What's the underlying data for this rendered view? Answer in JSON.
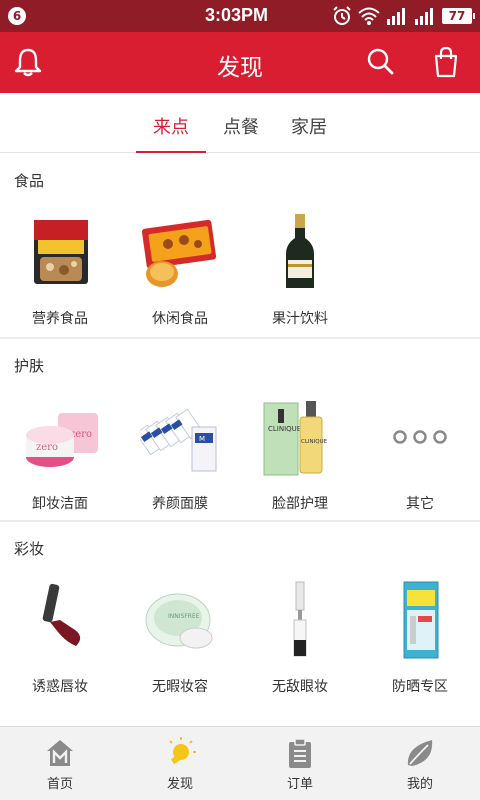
{
  "status_bar": {
    "notification_count": "6",
    "time": "3:03PM",
    "battery": "77",
    "icons": [
      "alarm-icon",
      "wifi-icon",
      "signal-icon",
      "signal-icon"
    ]
  },
  "header": {
    "title": "发现",
    "left_icon": "bell-icon",
    "right_icons": [
      "search-icon",
      "shopping-bag-icon"
    ]
  },
  "tabs": [
    {
      "label": "来点",
      "active": true
    },
    {
      "label": "点餐",
      "active": false
    },
    {
      "label": "家居",
      "active": false
    }
  ],
  "sections": [
    {
      "title": "食品",
      "items": [
        {
          "label": "营养食品",
          "icon": "muesli-icon"
        },
        {
          "label": "休闲食品",
          "icon": "snacks-icon"
        },
        {
          "label": "果汁饮料",
          "icon": "champagne-bottle-icon"
        }
      ]
    },
    {
      "title": "护肤",
      "items": [
        {
          "label": "卸妆洁面",
          "icon": "cleansing-cream-icon"
        },
        {
          "label": "养颜面膜",
          "icon": "face-mask-icon"
        },
        {
          "label": "脸部护理",
          "icon": "skincare-bottles-icon"
        },
        {
          "label": "其它",
          "icon": "more-dots-icon"
        }
      ]
    },
    {
      "title": "彩妆",
      "items": [
        {
          "label": "诱惑唇妆",
          "icon": "lipstick-icon"
        },
        {
          "label": "无暇妆容",
          "icon": "compact-powder-icon"
        },
        {
          "label": "无敌眼妆",
          "icon": "mascara-icon"
        },
        {
          "label": "防晒专区",
          "icon": "sunscreen-icon"
        }
      ]
    }
  ],
  "bottom_nav": [
    {
      "label": "首页",
      "icon": "home-icon",
      "active": false
    },
    {
      "label": "发现",
      "icon": "lightbulb-icon",
      "active": true
    },
    {
      "label": "订单",
      "icon": "clipboard-icon",
      "active": false
    },
    {
      "label": "我的",
      "icon": "leaf-icon",
      "active": false
    }
  ],
  "colors": {
    "brand_red": "#d81e30",
    "status_bar": "#8f1c27",
    "active_nav": "#f5c518",
    "inactive_nav": "#8a8a8a"
  }
}
